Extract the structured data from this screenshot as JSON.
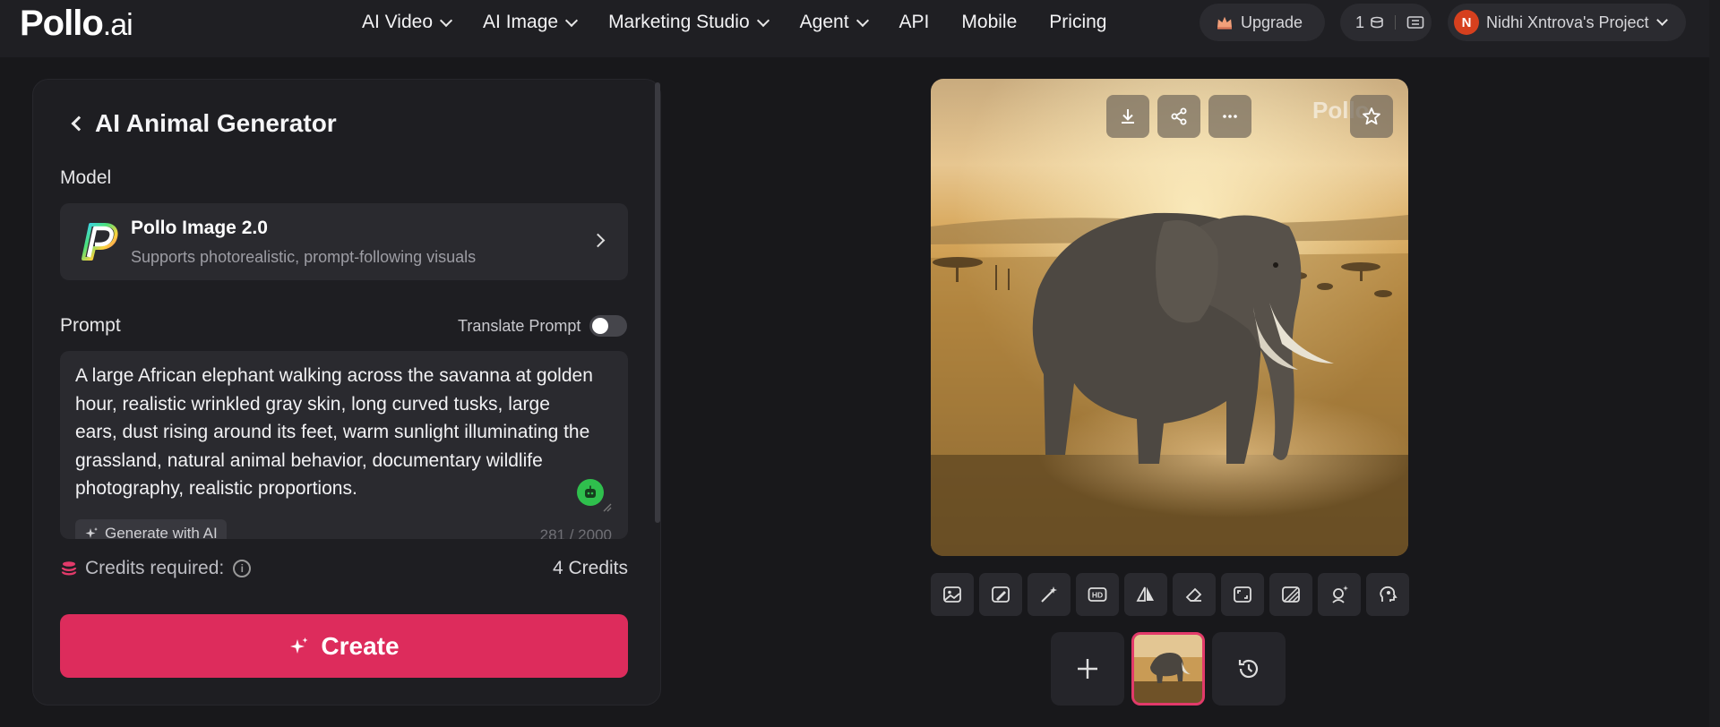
{
  "brand": {
    "name": "Pollo",
    "suffix": ".ai"
  },
  "nav": {
    "items": [
      {
        "label": "AI Video",
        "dropdown": true
      },
      {
        "label": "AI Image",
        "dropdown": true
      },
      {
        "label": "Marketing Studio",
        "dropdown": true
      },
      {
        "label": "Agent",
        "dropdown": true
      },
      {
        "label": "API",
        "dropdown": false
      },
      {
        "label": "Mobile",
        "dropdown": false
      },
      {
        "label": "Pricing",
        "dropdown": false
      }
    ],
    "upgrade_label": "Upgrade",
    "credits_value": "1",
    "project": {
      "avatar_letter": "N",
      "name": "Nidhi Xntrova's Project"
    }
  },
  "panel": {
    "title": "AI Animal Generator",
    "model_label": "Model",
    "model": {
      "name": "Pollo Image 2.0",
      "description": "Supports photorealistic, prompt-following visuals"
    },
    "prompt_label": "Prompt",
    "translate_label": "Translate Prompt",
    "translate_enabled": false,
    "prompt_text": "A large African elephant walking across the savanna at golden hour, realistic wrinkled gray skin, long curved tusks, large ears, dust rising around its feet, warm sunlight illuminating the grassland, natural animal behavior, documentary wildlife photography, realistic proportions.",
    "generate_ai_label": "Generate with AI",
    "char_count": "281 / 2000",
    "credits_label": "Credits required:",
    "credits_value": "4 Credits",
    "create_label": "Create"
  },
  "preview": {
    "watermark": "Pollo",
    "actions": [
      "download-icon",
      "share-icon",
      "more-icon",
      "star-icon"
    ],
    "tools": [
      "image-to-image-icon",
      "image-edit-icon",
      "magic-wand-icon",
      "hd-upscale-icon",
      "mirror-icon",
      "eraser-icon",
      "expand-icon",
      "remove-bg-icon",
      "face-swap-icon",
      "head-profile-icon"
    ],
    "hd_text": "HD"
  },
  "colors": {
    "accent": "#dd2c5c",
    "background": "#18181b",
    "panel": "#1e1e22"
  }
}
